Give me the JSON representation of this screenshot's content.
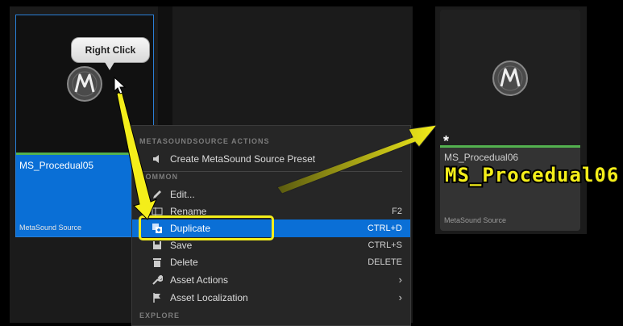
{
  "left_asset": {
    "name": "MS_Procedual05",
    "type": "MetaSound Source"
  },
  "callout": {
    "text": "Right Click"
  },
  "context_menu": {
    "sections": {
      "metasound": "METASOUNDSOURCE ACTIONS",
      "common": "COMMON",
      "explore": "EXPLORE"
    },
    "items": [
      {
        "label": "Create MetaSound Source Preset",
        "shortcut": "",
        "icon": "speaker-icon"
      },
      {
        "label": "Edit...",
        "shortcut": "",
        "icon": "pencil-icon"
      },
      {
        "label": "Rename",
        "shortcut": "F2",
        "icon": "rename-icon"
      },
      {
        "label": "Duplicate",
        "shortcut": "CTRL+D",
        "icon": "duplicate-icon",
        "highlighted": true
      },
      {
        "label": "Save",
        "shortcut": "CTRL+S",
        "icon": "save-icon"
      },
      {
        "label": "Delete",
        "shortcut": "DELETE",
        "icon": "trash-icon"
      },
      {
        "label": "Asset Actions",
        "shortcut": "",
        "icon": "wrench-icon",
        "submenu": true
      },
      {
        "label": "Asset Localization",
        "shortcut": "",
        "icon": "flag-icon",
        "submenu": true
      }
    ]
  },
  "right_asset": {
    "name": "MS_Procedual06",
    "type": "MetaSound Source",
    "unsaved_marker": "*"
  },
  "annotation": {
    "new_name": "MS_Procedual06"
  },
  "colors": {
    "selection_blue": "#0a6fd6",
    "highlight_yellow": "#f4ee1a",
    "asset_green": "#53b14f"
  }
}
